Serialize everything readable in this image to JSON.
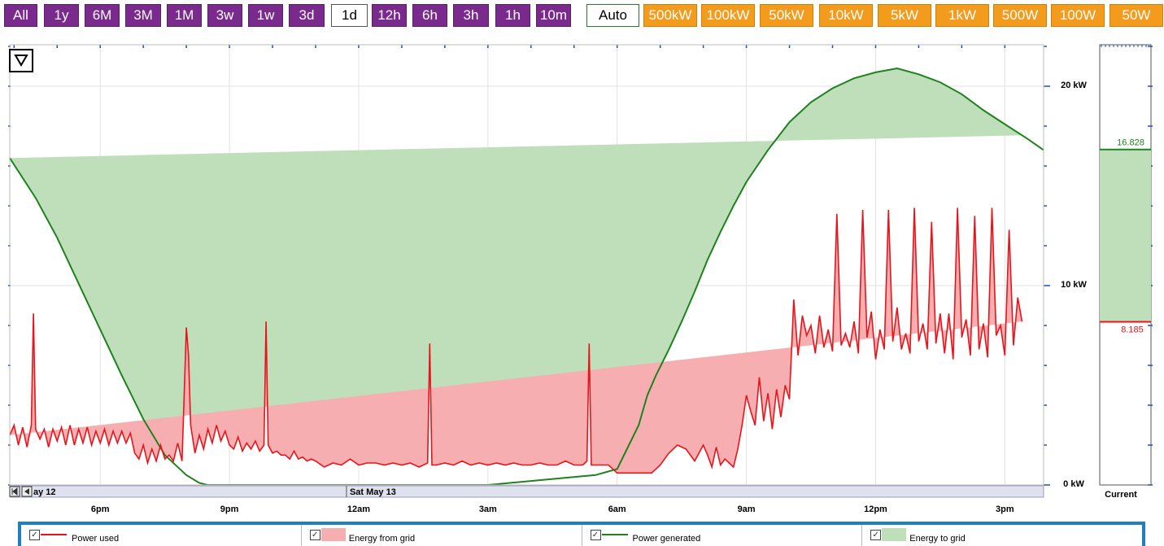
{
  "toolbar": {
    "ranges": [
      "All",
      "1y",
      "6M",
      "3M",
      "1M",
      "3w",
      "1w",
      "3d",
      "1d",
      "12h",
      "6h",
      "3h",
      "1h",
      "10m"
    ],
    "selected_range": "1d",
    "auto_label": "Auto",
    "scales": [
      "500kW",
      "100kW",
      "50kW",
      "10kW",
      "5kW",
      "1kW",
      "500W",
      "100W",
      "50W"
    ]
  },
  "nav": {
    "first_icon": "skip-to-start-icon",
    "prev_icon": "previous-icon",
    "date_left": "ay 12",
    "date_right": "Sat May 13"
  },
  "menu_icon": "triangle-down-menu-icon",
  "current": {
    "label": "Current",
    "generated": "16.828",
    "used": "8.185"
  },
  "colors": {
    "used_line": "#e8141b",
    "grid_fill": "#f7aeb0",
    "generated_line": "#1e821e",
    "to_grid_fill": "#bfdfbb",
    "range_button": "#7a2a8c",
    "scale_button": "#f29b1d",
    "legend_border": "#1e7fc1"
  },
  "chart_data": {
    "type": "area",
    "x_tick_labels": [
      "6pm",
      "9pm",
      "12am",
      "3am",
      "6am",
      "9am",
      "12pm",
      "3pm"
    ],
    "y_tick_labels": [
      "0 kW",
      "10 kW",
      "20 kW"
    ],
    "ylim": [
      0,
      22
    ],
    "x_range_hours": [
      15.9,
      39.9
    ],
    "series": [
      {
        "name": "Power generated",
        "x_hours": [
          15.9,
          16.5,
          17.0,
          17.5,
          18.0,
          18.5,
          19.0,
          19.5,
          20.0,
          20.3,
          20.5,
          21.0,
          27.0,
          29.5,
          30.0,
          30.5,
          30.7,
          30.9,
          31.2,
          31.5,
          31.8,
          32.1,
          32.4,
          32.7,
          33.0,
          33.5,
          34.0,
          34.5,
          35.0,
          35.5,
          36.0,
          36.5,
          37.0,
          37.5,
          38.0,
          38.5,
          39.0,
          39.5,
          39.9
        ],
        "values_kw": [
          16.4,
          14.4,
          12.4,
          10.1,
          7.8,
          5.5,
          3.3,
          1.5,
          0.5,
          0.1,
          0.0,
          0.0,
          0.0,
          0.5,
          0.8,
          3.0,
          4.5,
          5.5,
          6.8,
          8.2,
          9.7,
          11.3,
          12.7,
          14.0,
          15.2,
          16.8,
          18.2,
          19.2,
          19.9,
          20.4,
          20.7,
          20.9,
          20.6,
          20.2,
          19.6,
          18.8,
          18.1,
          17.4,
          16.8
        ]
      },
      {
        "name": "Power used",
        "x_hours": [
          15.9,
          16.0,
          16.1,
          16.2,
          16.3,
          16.4,
          16.45,
          16.5,
          16.6,
          16.7,
          16.8,
          16.9,
          17.0,
          17.1,
          17.2,
          17.3,
          17.4,
          17.5,
          17.6,
          17.7,
          17.8,
          17.9,
          18.0,
          18.1,
          18.2,
          18.3,
          18.4,
          18.5,
          18.6,
          18.7,
          18.8,
          18.9,
          19.0,
          19.1,
          19.2,
          19.3,
          19.4,
          19.5,
          19.6,
          19.7,
          19.8,
          19.9,
          20.0,
          20.05,
          20.1,
          20.2,
          20.3,
          20.4,
          20.5,
          20.6,
          20.7,
          20.8,
          20.9,
          21.0,
          21.1,
          21.2,
          21.3,
          21.4,
          21.5,
          21.6,
          21.7,
          21.8,
          21.85,
          21.9,
          22.0,
          22.1,
          22.2,
          22.3,
          22.4,
          22.5,
          22.6,
          22.7,
          22.8,
          22.9,
          23.0,
          23.2,
          23.4,
          23.6,
          23.8,
          24.0,
          24.2,
          24.4,
          24.6,
          24.8,
          25.0,
          25.2,
          25.4,
          25.6,
          25.65,
          25.7,
          25.8,
          26.0,
          26.2,
          26.4,
          26.6,
          26.8,
          27.0,
          27.2,
          27.4,
          27.6,
          27.8,
          28.0,
          28.2,
          28.4,
          28.6,
          28.8,
          29.0,
          29.2,
          29.3,
          29.35,
          29.4,
          29.6,
          29.8,
          30.0,
          30.2,
          30.4,
          30.6,
          30.8,
          31.0,
          31.2,
          31.4,
          31.6,
          31.8,
          32.0,
          32.1,
          32.2,
          32.3,
          32.4,
          32.5,
          32.6,
          32.7,
          32.8,
          32.9,
          33.0,
          33.1,
          33.2,
          33.3,
          33.4,
          33.5,
          33.6,
          33.7,
          33.8,
          33.9,
          34.0,
          34.1,
          34.2,
          34.3,
          34.4,
          34.5,
          34.6,
          34.7,
          34.8,
          34.9,
          35.0,
          35.1,
          35.2,
          35.3,
          35.4,
          35.5,
          35.6,
          35.7,
          35.8,
          35.9,
          36.0,
          36.1,
          36.2,
          36.3,
          36.4,
          36.5,
          36.6,
          36.7,
          36.8,
          36.9,
          37.0,
          37.1,
          37.2,
          37.3,
          37.4,
          37.5,
          37.6,
          37.7,
          37.8,
          37.9,
          38.0,
          38.1,
          38.2,
          38.3,
          38.4,
          38.5,
          38.6,
          38.7,
          38.8,
          38.9,
          39.0,
          39.1,
          39.2,
          39.3,
          39.4,
          39.5,
          39.6,
          39.7,
          39.8,
          39.9
        ],
        "values_kw": [
          2.5,
          3.0,
          2.0,
          2.9,
          1.9,
          3.0,
          8.6,
          2.8,
          2.3,
          2.8,
          1.9,
          2.8,
          2.2,
          2.9,
          2.0,
          3.0,
          2.0,
          2.8,
          2.1,
          2.9,
          2.0,
          2.7,
          2.1,
          2.8,
          2.0,
          2.7,
          2.1,
          2.7,
          2.1,
          2.6,
          1.6,
          1.3,
          2.0,
          1.1,
          1.8,
          1.2,
          2.0,
          1.3,
          1.5,
          1.2,
          2.1,
          1.2,
          7.9,
          6.5,
          3.0,
          1.6,
          2.5,
          1.8,
          2.8,
          2.1,
          3.0,
          2.2,
          2.7,
          2.0,
          1.8,
          2.4,
          1.7,
          2.1,
          1.8,
          2.2,
          1.7,
          2.0,
          8.2,
          2.0,
          1.6,
          1.7,
          1.5,
          1.5,
          1.3,
          1.7,
          1.3,
          1.4,
          1.2,
          1.3,
          1.2,
          0.9,
          1.1,
          1.0,
          1.3,
          1.0,
          1.1,
          1.1,
          1.0,
          1.1,
          1.0,
          1.1,
          0.9,
          1.1,
          7.1,
          1.0,
          1.0,
          1.1,
          1.0,
          1.2,
          1.0,
          1.1,
          1.0,
          1.1,
          1.0,
          1.1,
          1.0,
          1.0,
          1.1,
          1.0,
          1.0,
          1.2,
          1.0,
          1.0,
          1.2,
          7.1,
          1.0,
          1.0,
          1.0,
          0.6,
          0.6,
          0.6,
          0.6,
          0.6,
          1.0,
          1.6,
          2.0,
          1.8,
          1.2,
          2.0,
          1.5,
          0.9,
          1.9,
          1.0,
          1.3,
          1.1,
          0.9,
          1.8,
          3.0,
          4.5,
          3.7,
          3.0,
          5.4,
          3.2,
          4.6,
          2.8,
          4.8,
          3.4,
          5.0,
          4.3,
          9.3,
          6.5,
          8.5,
          7.5,
          8.0,
          6.6,
          8.5,
          6.9,
          7.8,
          6.7,
          13.6,
          7.0,
          7.6,
          6.9,
          8.2,
          6.6,
          13.8,
          7.4,
          8.7,
          6.3,
          7.8,
          6.8,
          13.8,
          7.2,
          8.9,
          6.8,
          7.6,
          6.6,
          13.9,
          7.2,
          8.1,
          6.8,
          13.2,
          7.1,
          8.6,
          6.6,
          8.6,
          6.3,
          13.9,
          7.4,
          8.3,
          6.5,
          13.5,
          6.8,
          8.1,
          6.4,
          13.9,
          7.5,
          8.0,
          6.5,
          12.8,
          7.0,
          9.4,
          8.2
        ]
      }
    ]
  },
  "legend": [
    {
      "label": "Power used",
      "kind": "line",
      "color": "#e8141b"
    },
    {
      "label": "Energy from grid",
      "kind": "fill",
      "color": "#f7aeb0"
    },
    {
      "label": "Power generated",
      "kind": "line",
      "color": "#1e821e"
    },
    {
      "label": "Energy to grid",
      "kind": "fill",
      "color": "#bfdfbb"
    }
  ]
}
